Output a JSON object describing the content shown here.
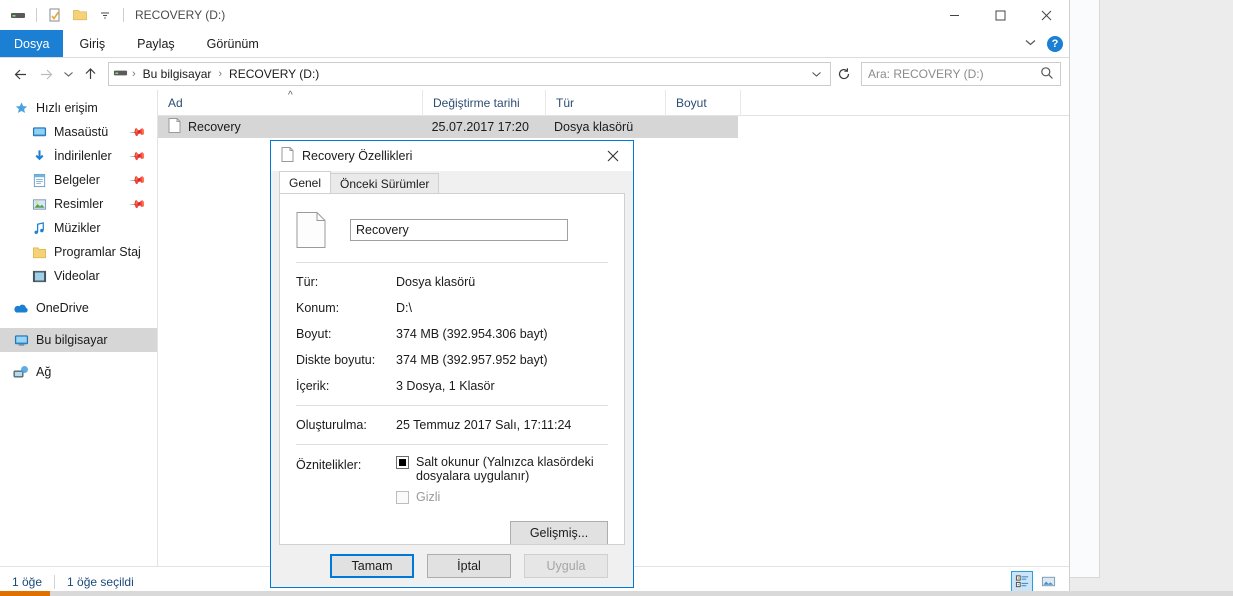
{
  "window": {
    "title": "RECOVERY (D:)",
    "quick_access": [
      {
        "name": "drive-icon",
        "label": "RECOVERY (D:)"
      },
      {
        "name": "properties-icon",
        "label": "Özellikler"
      },
      {
        "name": "new-folder-icon",
        "label": "Yeni klasör"
      },
      {
        "name": "customize-dropdown-icon",
        "label": "Hızlı Erişim Araç Çubuğunu Özelleştir"
      }
    ],
    "controls": {
      "minimize": "Simge Durumuna Küçült",
      "maximize": "Ekranı Kapla",
      "close": "Kapat"
    }
  },
  "ribbon": {
    "tabs": [
      {
        "label": "Dosya",
        "active": true
      },
      {
        "label": "Giriş",
        "active": false
      },
      {
        "label": "Paylaş",
        "active": false
      },
      {
        "label": "Görünüm",
        "active": false
      }
    ],
    "expand_label": "Şeridi Genişlet",
    "help_label": "?"
  },
  "navigation": {
    "back": "◄",
    "forward": "►",
    "recent": "▼",
    "up": "▲",
    "breadcrumbs": [
      "Bu bilgisayar",
      "RECOVERY (D:)"
    ],
    "separator": "›",
    "dropdown": "▼",
    "refresh": "↻"
  },
  "search": {
    "placeholder": "Ara: RECOVERY (D:)",
    "icon": "search-icon"
  },
  "sidebar": {
    "items": [
      {
        "label": "Hızlı erişim",
        "icon": "star-icon",
        "level": 0,
        "pinned": false,
        "selected": false
      },
      {
        "label": "Masaüstü",
        "icon": "desktop-icon",
        "level": 1,
        "pinned": true,
        "selected": false
      },
      {
        "label": "İndirilenler",
        "icon": "downloads-icon",
        "level": 1,
        "pinned": true,
        "selected": false
      },
      {
        "label": "Belgeler",
        "icon": "documents-icon",
        "level": 1,
        "pinned": true,
        "selected": false
      },
      {
        "label": "Resimler",
        "icon": "pictures-icon",
        "level": 1,
        "pinned": true,
        "selected": false
      },
      {
        "label": "Müzikler",
        "icon": "music-icon",
        "level": 1,
        "pinned": false,
        "selected": false
      },
      {
        "label": "Programlar Staj",
        "icon": "folder-icon",
        "level": 1,
        "pinned": false,
        "selected": false
      },
      {
        "label": "Videolar",
        "icon": "videos-icon",
        "level": 1,
        "pinned": false,
        "selected": false
      },
      {
        "label": "OneDrive",
        "icon": "onedrive-icon",
        "level": 0,
        "pinned": false,
        "selected": false
      },
      {
        "label": "Bu bilgisayar",
        "icon": "this-pc-icon",
        "level": 0,
        "pinned": false,
        "selected": true
      },
      {
        "label": "Ağ",
        "icon": "network-icon",
        "level": 0,
        "pinned": false,
        "selected": false
      }
    ]
  },
  "filelist": {
    "columns": [
      "Ad",
      "Değiştirme tarihi",
      "Tür",
      "Boyut"
    ],
    "sort_indicator": "^",
    "rows": [
      {
        "name": "Recovery",
        "modified": "25.07.2017 17:20",
        "type": "Dosya klasörü",
        "size": "",
        "icon": "file-icon",
        "selected": true
      }
    ]
  },
  "statusbar": {
    "item_count": "1 öğe",
    "selection": "1 öğe seçildi",
    "views": [
      {
        "name": "details-view-button",
        "active": true
      },
      {
        "name": "large-icons-view-button",
        "active": false
      }
    ]
  },
  "dialog": {
    "title": "Recovery Özellikleri",
    "title_icon": "file-icon",
    "close_label": "✕",
    "tabs": [
      {
        "label": "Genel",
        "active": true
      },
      {
        "label": "Önceki Sürümler",
        "active": false
      }
    ],
    "name_value": "Recovery",
    "properties": [
      {
        "label": "Tür:",
        "value": "Dosya klasörü"
      },
      {
        "label": "Konum:",
        "value": "D:\\"
      },
      {
        "label": "Boyut:",
        "value": "374 MB (392.954.306 bayt)"
      },
      {
        "label": "Diskte boyutu:",
        "value": "374 MB (392.957.952 bayt)"
      },
      {
        "label": "İçerik:",
        "value": "3 Dosya, 1 Klasör"
      }
    ],
    "created": {
      "label": "Oluşturulma:",
      "value": "25 Temmuz 2017 Salı, 17:11:24"
    },
    "attributes": {
      "label": "Öznitelikler:",
      "readonly": {
        "label": "Salt okunur (Yalnızca klasördeki dosyalara uygulanır)",
        "state": "indeterminate"
      },
      "hidden": {
        "label": "Gizli",
        "state": "unchecked-disabled"
      }
    },
    "advanced_button": "Gelişmiş...",
    "buttons": [
      {
        "label": "Tamam",
        "default": true,
        "disabled": false
      },
      {
        "label": "İptal",
        "default": false,
        "disabled": false
      },
      {
        "label": "Uygula",
        "default": false,
        "disabled": true
      }
    ]
  },
  "colors": {
    "accent": "#1b7fd4",
    "focus": "#0078d7",
    "selection": "#d6d6d6",
    "header_text": "#2b4d73"
  }
}
